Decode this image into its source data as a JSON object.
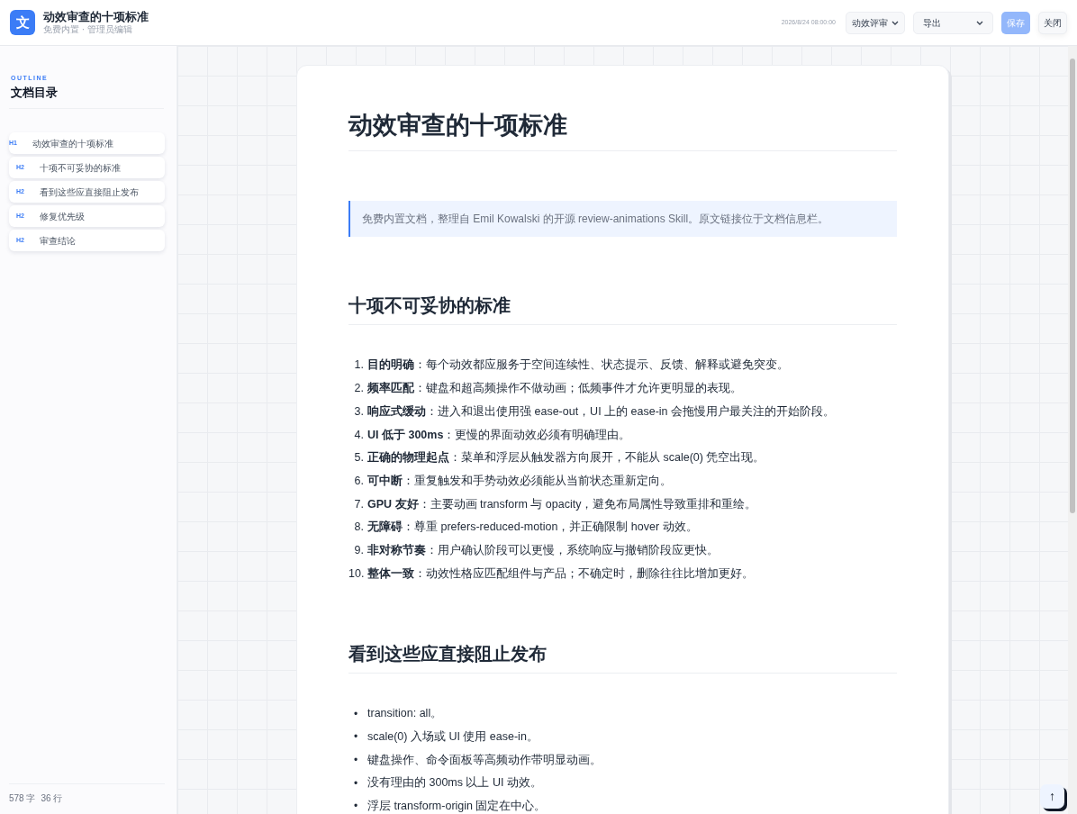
{
  "header": {
    "logo": "文",
    "title": "动效审查的十项标准",
    "subtitle": "免费内置 · 管理员编辑",
    "timestamp": "2026/8/24 08:00:00",
    "mode_select": "动效评审",
    "export_select": "导出",
    "save_button": {
      "label": "保存",
      "disabled": true
    },
    "close_button": "关闭"
  },
  "outline": {
    "eyebrow": "OUTLINE",
    "title": "文档目录",
    "items": [
      {
        "level": "H1",
        "label": "动效审查的十项标准",
        "children": [
          {
            "level": "H2",
            "label": "十项不可妥协的标准"
          },
          {
            "level": "H2",
            "label": "看到这些应直接阻止发布"
          },
          {
            "level": "H2",
            "label": "修复优先级"
          },
          {
            "level": "H2",
            "label": "审查结论"
          }
        ]
      }
    ]
  },
  "stats": {
    "chars": "578 字",
    "lines": "36 行"
  },
  "document": {
    "title": "动效审查的十项标准",
    "note": "免费内置文档，整理自 Emil Kowalski 的开源 review-animations Skill。原文链接位于文档信息栏。",
    "sections": [
      {
        "heading": "十项不可妥协的标准",
        "kind": "ordered",
        "items": [
          {
            "marker": "1.",
            "text": "**目的明确**：每个动效都应服务于空间连续性、状态提示、反馈、解释或避免突变。"
          },
          {
            "marker": "2.",
            "text": "**频率匹配**：键盘和超高频操作不做动画；低频事件才允许更明显的表现。"
          },
          {
            "marker": "3.",
            "text": "**响应式缓动**：进入和退出使用强 ease-out，UI 上的 ease-in 会拖慢用户最关注的开始阶段。"
          },
          {
            "marker": "4.",
            "text": "**UI 低于 300ms**：更慢的界面动效必须有明确理由。"
          },
          {
            "marker": "5.",
            "text": "**正确的物理起点**：菜单和浮层从触发器方向展开，不能从 scale(0) 凭空出现。"
          },
          {
            "marker": "6.",
            "text": "**可中断**：重复触发和手势动效必须能从当前状态重新定向。"
          },
          {
            "marker": "7.",
            "text": "**GPU 友好**：主要动画 transform 与 opacity，避免布局属性导致重排和重绘。"
          },
          {
            "marker": "8.",
            "text": "**无障碍**：尊重 prefers-reduced-motion，并正确限制 hover 动效。"
          },
          {
            "marker": "9.",
            "text": "**非对称节奏**：用户确认阶段可以更慢，系统响应与撤销阶段应更快。"
          },
          {
            "marker": "10.",
            "text": "**整体一致**：动效性格应匹配组件与产品；不确定时，删除往往比增加更好。"
          }
        ]
      },
      {
        "heading": "看到这些应直接阻止发布",
        "kind": "bullet",
        "items": [
          {
            "marker": "•",
            "text": "transition: all。"
          },
          {
            "marker": "•",
            "text": "scale(0) 入场或 UI 使用 ease-in。"
          },
          {
            "marker": "•",
            "text": "键盘操作、命令面板等高频动作带明显动画。"
          },
          {
            "marker": "•",
            "text": "没有理由的 300ms 以上 UI 动效。"
          },
          {
            "marker": "•",
            "text": "浮层 transform-origin 固定在中心。"
          }
        ]
      }
    ]
  },
  "back_to_top": "↑"
}
